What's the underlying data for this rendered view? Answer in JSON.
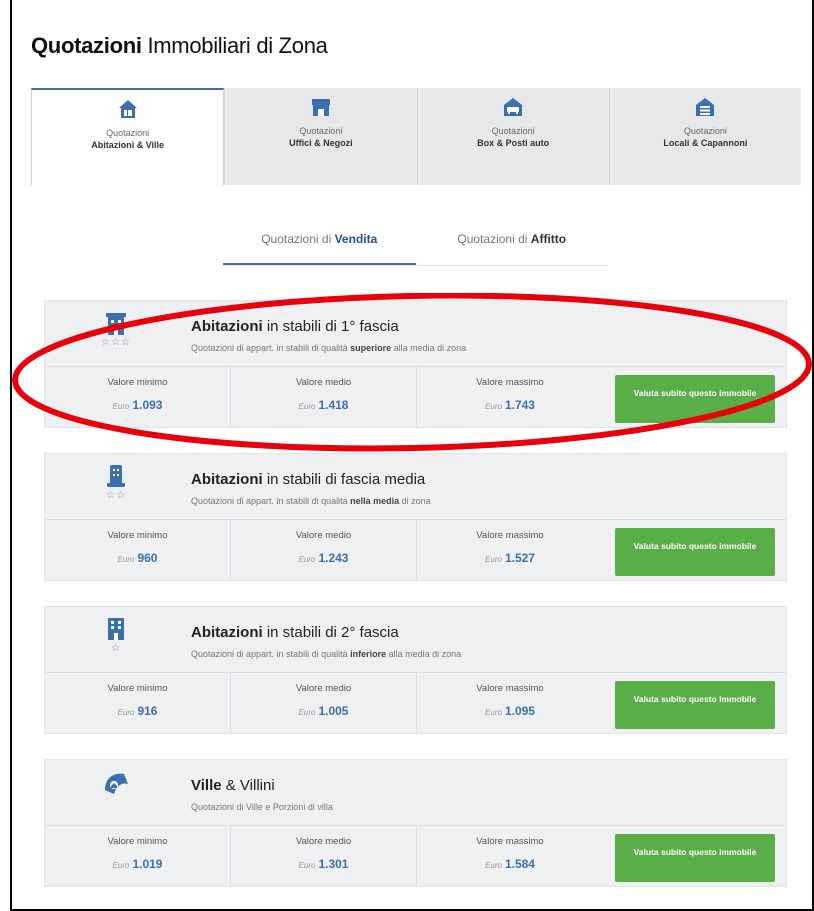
{
  "header": {
    "title_bold": "Quotazioni",
    "title_light": "Immobiliari di Zona"
  },
  "tabs": [
    {
      "line1": "Quotazioni",
      "line2": "Abitazioni & Ville",
      "icon": "house-icon"
    },
    {
      "line1": "Quotazioni",
      "line2": "Uffici & Negozi",
      "icon": "shop-icon"
    },
    {
      "line1": "Quotazioni",
      "line2": "Box & Posti auto",
      "icon": "garage-car-icon"
    },
    {
      "line1": "Quotazioni",
      "line2": "Locali & Capannoni",
      "icon": "warehouse-icon"
    }
  ],
  "subtabs": [
    {
      "prefix": "Quotazioni di ",
      "bold": "Vendita"
    },
    {
      "prefix": "Quotazioni di ",
      "bold": "Affitto"
    }
  ],
  "labels": {
    "min": "Valore minimo",
    "mid": "Valore medio",
    "max": "Valore massimo",
    "currency": "Euro",
    "button": "Valuta subito questo immobile"
  },
  "cards": [
    {
      "title_bold": "Abitazioni",
      "title_rest": " in stabili di 1° fascia",
      "sub_pre": "Quotazioni di appart. in stabili di qualità ",
      "sub_bold": "superiore",
      "sub_post": " alla media di zona",
      "stars": "☆☆☆",
      "min": "1.093",
      "mid": "1.418",
      "max": "1.743"
    },
    {
      "title_bold": "Abitazioni",
      "title_rest": " in stabili di fascia media",
      "sub_pre": "Quotazioni di appart. in stabili di qualità ",
      "sub_bold": "nella media",
      "sub_post": " di zona",
      "stars": "☆☆",
      "min": "960",
      "mid": "1.243",
      "max": "1.527"
    },
    {
      "title_bold": "Abitazioni",
      "title_rest": " in stabili di 2° fascia",
      "sub_pre": "Quotazioni di appart. in stabili di qualità ",
      "sub_bold": "inferiore",
      "sub_post": " alla media di zona",
      "stars": "☆",
      "min": "916",
      "mid": "1.005",
      "max": "1.095"
    },
    {
      "title_bold": "Ville",
      "title_rest": " & Villini",
      "sub_pre": "Quotazioni di Ville e Porzioni di villa",
      "sub_bold": "",
      "sub_post": "",
      "stars": "",
      "min": "1.019",
      "mid": "1.301",
      "max": "1.584"
    }
  ],
  "colors": {
    "accent": "#3d6fae",
    "button": "#5aae47",
    "annotation": "#e8000b"
  }
}
